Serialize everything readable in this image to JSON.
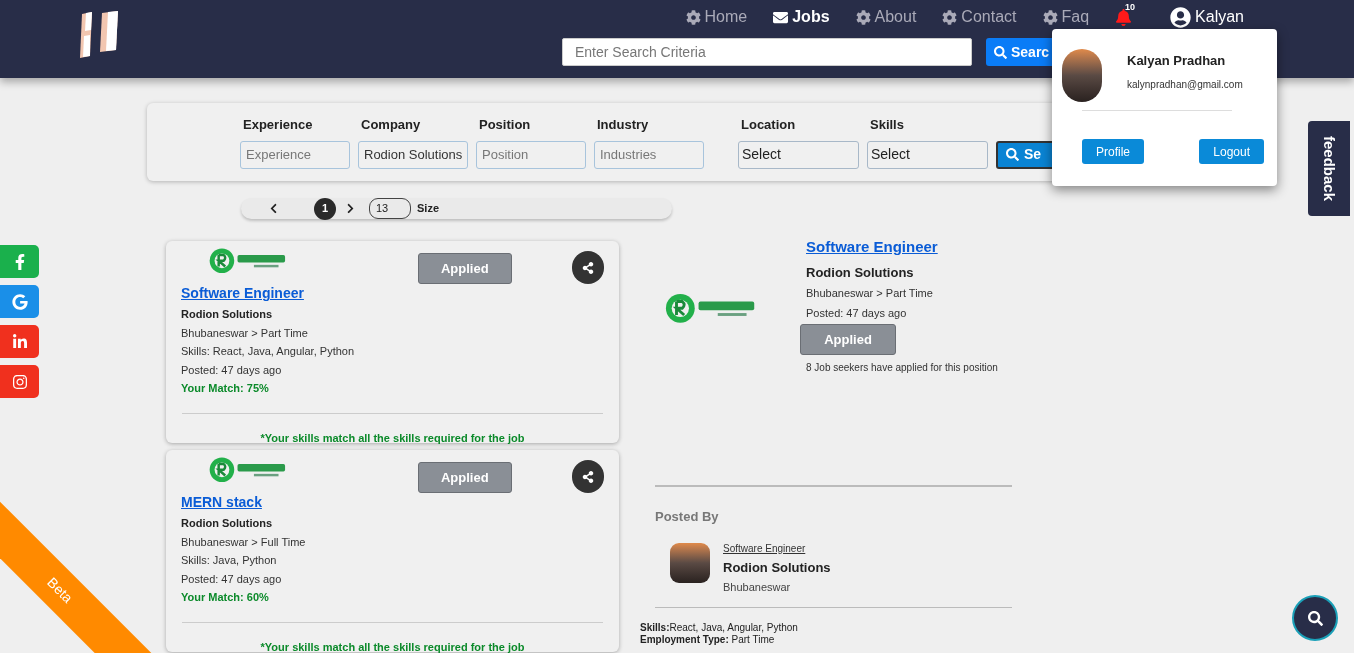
{
  "nav": {
    "items": [
      {
        "label": "Home",
        "kind": "gear",
        "selected": false
      },
      {
        "label": "Jobs",
        "kind": "envelope",
        "selected": true
      },
      {
        "label": "About",
        "kind": "gear",
        "selected": false
      },
      {
        "label": "Contact",
        "kind": "gear",
        "selected": false
      },
      {
        "label": "Faq",
        "kind": "gear",
        "selected": false
      }
    ],
    "notification_count": "10",
    "user": "Kalyan"
  },
  "search": {
    "placeholder": "Enter Search Criteria",
    "button": "Searc"
  },
  "user_menu": {
    "name": "Kalyan Pradhan",
    "email": "kalynpradhan@gmail.com",
    "buttons": [
      "Profile",
      "Logout"
    ]
  },
  "filters": [
    {
      "label": "Experience",
      "kind": "input",
      "placeholder": "Experience"
    },
    {
      "label": "Company",
      "kind": "input",
      "value": "Rodion Solutions"
    },
    {
      "label": "Position",
      "kind": "input",
      "placeholder": "Position"
    },
    {
      "label": "Industry",
      "kind": "input",
      "placeholder": "Industries"
    },
    {
      "label": "Location",
      "kind": "select",
      "value": "Select"
    },
    {
      "label": "Skills",
      "kind": "select",
      "value": "Select"
    }
  ],
  "filter_button": "Se",
  "pagination": {
    "page": "1",
    "size": "13",
    "size_label": "Size"
  },
  "social": [
    {
      "kind": "facebook",
      "color": "#1ab04c"
    },
    {
      "kind": "google",
      "color": "#1a8fe8"
    },
    {
      "kind": "linkedin",
      "color": "#f0301e"
    },
    {
      "kind": "instagram",
      "color": "#f0301e"
    }
  ],
  "jobs": [
    {
      "title": "Software Engineer",
      "company": "Rodion Solutions",
      "location": "Bhubaneswar > Part Time",
      "skills": "Skills: React, Java, Angular, Python",
      "posted": "Posted: 47 days ago",
      "match": "Your Match: 75%",
      "note": "*Your skills match all the skills required for the job",
      "status": "Applied"
    },
    {
      "title": "MERN stack",
      "company": "Rodion Solutions",
      "location": "Bhubaneswar > Full Time",
      "skills": "Skills: Java, Python",
      "posted": "Posted: 47 days ago",
      "match": "Your Match: 60%",
      "note": "*Your skills match all the skills required for the job",
      "status": "Applied"
    }
  ],
  "detail": {
    "title": "Software Engineer",
    "company": "Rodion Solutions",
    "location": "Bhubaneswar > Part Time",
    "posted": "Posted: 47 days ago",
    "status": "Applied",
    "applicants": "8 Job seekers have applied for this position",
    "posted_by": "Posted By",
    "poster": {
      "role": "Software Engineer",
      "company": "Rodion Solutions",
      "city": "Bhubaneswar"
    },
    "skills_label": "Skills:",
    "skills": "React, Java, Angular, Python",
    "employment_label": "Employment Type:",
    "employment": "Part Time"
  },
  "feedback": "feedback",
  "beta": "Beta"
}
